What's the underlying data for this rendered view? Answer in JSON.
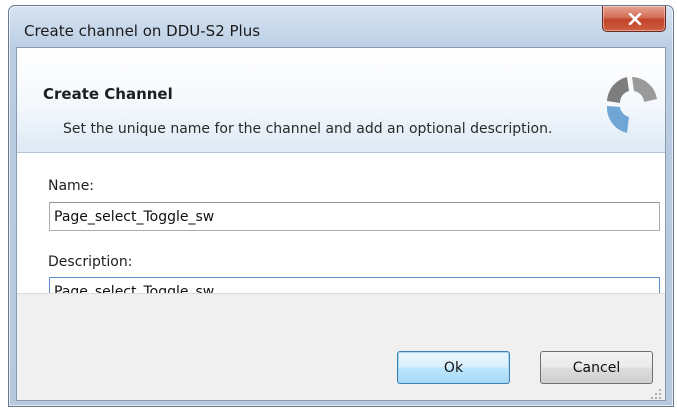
{
  "window": {
    "title": "Create channel on DDU-S2 Plus",
    "close_icon": "close-x-icon"
  },
  "header": {
    "title": "Create Channel",
    "subtitle": "Set the unique name for the channel and add an optional description.",
    "logo_icon": "app-logo-icon"
  },
  "form": {
    "name_label": "Name:",
    "name_value": "Page_select_Toggle_sw",
    "description_label": "Description:",
    "description_value": "Page_select_Toggle_sw"
  },
  "buttons": {
    "ok_label": "Ok",
    "cancel_label": "Cancel"
  },
  "colors": {
    "close_button": "#c8503a",
    "default_button_border": "#3c7fb1",
    "focus_border": "#5b8fc7",
    "logo_gray": "#8a8a8a",
    "logo_blue": "#6fa6d6"
  }
}
